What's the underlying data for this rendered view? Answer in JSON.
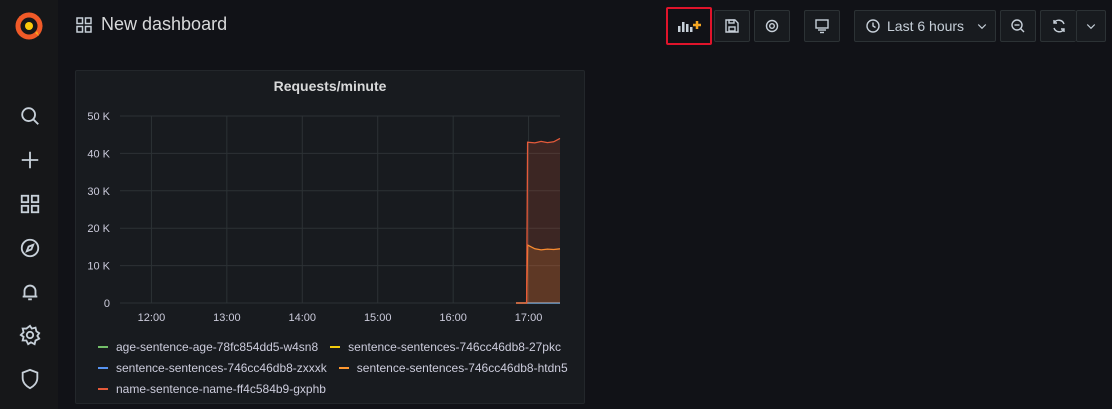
{
  "dashboard": {
    "title": "New dashboard"
  },
  "toolbar": {
    "time_range": "Last 6 hours",
    "buttons": [
      "add-panel",
      "save",
      "settings",
      "view-mode",
      "time-picker",
      "zoom-out",
      "refresh",
      "refresh-options"
    ]
  },
  "sidebar": {
    "icons": [
      "grafana-logo-icon",
      "search-icon",
      "plus-icon",
      "dashboards-icon",
      "explore-icon",
      "alerting-icon",
      "settings-icon",
      "shield-icon"
    ]
  },
  "panel": {
    "title": "Requests/minute"
  },
  "colors": {
    "accent": "#f2495c",
    "highlight": "#e0142b",
    "series_green": "#73bf69",
    "series_yellow": "#f2cc0c",
    "series_blue": "#5794f2",
    "series_orange": "#ff9830",
    "series_red": "#e45a3a"
  },
  "chart_data": {
    "type": "area",
    "title": "Requests/minute",
    "xlabel": "",
    "ylabel": "",
    "x_ticks": [
      "12:00",
      "13:00",
      "14:00",
      "15:00",
      "16:00",
      "17:00"
    ],
    "y_ticks": [
      "0",
      "10 K",
      "20 K",
      "30 K",
      "40 K",
      "50 K"
    ],
    "ylim": [
      0,
      50000
    ],
    "grid": true,
    "legend_position": "bottom",
    "x": [
      "16:50",
      "16:53",
      "16:55",
      "16:57",
      "17:00",
      "17:05",
      "17:10",
      "17:15",
      "17:20",
      "17:25"
    ],
    "series": [
      {
        "name": "age-sentence-age-78fc854dd5-w4sn8",
        "color": "#73bf69",
        "values": [
          0,
          0,
          0,
          0,
          0,
          0,
          0,
          0,
          0,
          0
        ]
      },
      {
        "name": "sentence-sentences-746cc46db8-27pkc",
        "color": "#f2cc0c",
        "values": [
          0,
          0,
          0,
          0,
          0,
          0,
          0,
          0,
          0,
          0
        ]
      },
      {
        "name": "sentence-sentences-746cc46db8-zxxxk",
        "color": "#5794f2",
        "values": [
          0,
          0,
          0,
          0,
          0,
          0,
          0,
          0,
          0,
          0
        ]
      },
      {
        "name": "sentence-sentences-746cc46db8-htdn5",
        "color": "#ff9830",
        "values": [
          0,
          0,
          0,
          0,
          15500,
          14500,
          14200,
          14400,
          14300,
          14500
        ]
      },
      {
        "name": "name-sentence-name-ff4c584b9-gxphb",
        "color": "#e45a3a",
        "values": [
          0,
          0,
          0,
          0,
          43000,
          42800,
          43200,
          42900,
          43100,
          44000
        ]
      }
    ]
  }
}
